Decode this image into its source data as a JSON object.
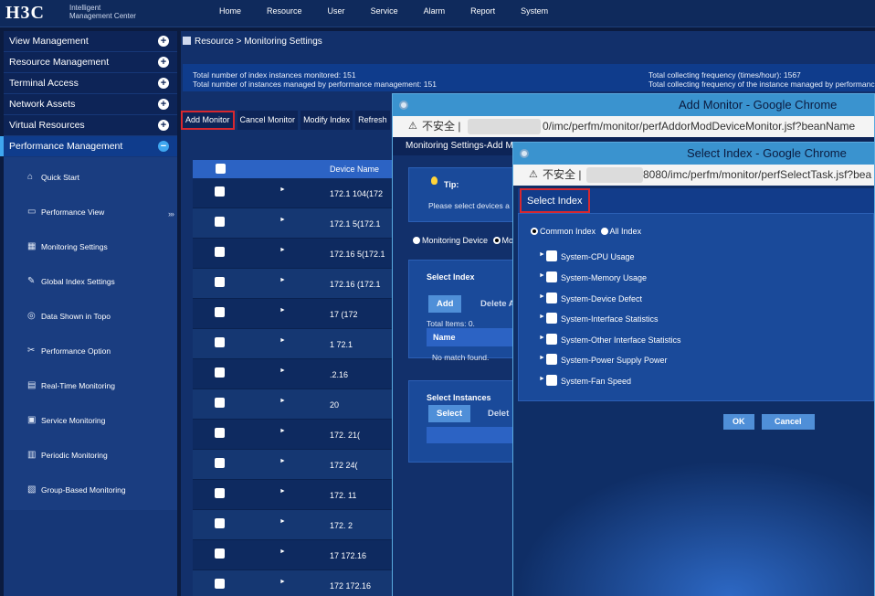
{
  "app": {
    "logo": "H3C",
    "logo_sub_1": "Intelligent",
    "logo_sub_2": "Management Center"
  },
  "topnav": [
    "Home",
    "Resource",
    "User",
    "Service",
    "Alarm",
    "Report",
    "System"
  ],
  "sidebar": {
    "menus": [
      {
        "label": "View Management",
        "icon": "plus-icon"
      },
      {
        "label": "Resource Management",
        "icon": "plus-icon"
      },
      {
        "label": "Terminal Access",
        "icon": "plus-icon"
      },
      {
        "label": "Network Assets",
        "icon": "plus-icon"
      },
      {
        "label": "Virtual Resources",
        "icon": "plus-icon"
      },
      {
        "label": "Performance Management",
        "icon": "minus-icon"
      }
    ],
    "sub_items": [
      {
        "label": "Quick Start",
        "icon": "home-icon"
      },
      {
        "label": "Performance View",
        "icon": "monitor-icon"
      },
      {
        "label": "Monitoring Settings",
        "icon": "settings-icon"
      },
      {
        "label": "Global Index Settings",
        "icon": "edit-icon"
      },
      {
        "label": "Data Shown in Topo",
        "icon": "topo-icon"
      },
      {
        "label": "Performance Option",
        "icon": "wrench-icon"
      },
      {
        "label": "Real-Time Monitoring",
        "icon": "realtime-icon"
      },
      {
        "label": "Service Monitoring",
        "icon": "service-icon"
      },
      {
        "label": "Periodic Monitoring",
        "icon": "periodic-icon"
      },
      {
        "label": "Group-Based Monitoring",
        "icon": "group-icon"
      }
    ],
    "expand_glyph": "›››"
  },
  "breadcrumb": "Resource > Monitoring Settings",
  "stats": {
    "line1": "Total number of index instances monitored: 151",
    "line2": "Total number of instances managed by performance management: 151",
    "line3": "Total collecting frequency (times/hour): 1567",
    "line4": "Total collecting frequency of the instance managed by performance"
  },
  "toolbar": {
    "add": "Add Monitor",
    "cancel": "Cancel Monitor",
    "modify": "Modify Index",
    "refresh": "Refresh"
  },
  "table": {
    "header": "Device Name",
    "rows": [
      "172.1     104(172",
      "172.1     5(172.1",
      "172.16    5(172.1",
      "172.16    (172.1",
      "17         (172",
      "1          72.1",
      "           .2.16",
      "            20",
      "172.       21(",
      "172        24(",
      "172.        11",
      "172.        2",
      "17         172.16",
      "172         172.16"
    ]
  },
  "dialog_add": {
    "title": "Add Monitor - Google Chrome",
    "secure_label": "不安全 |",
    "url": "0/imc/perfm/monitor/perfAddorModDeviceMonitor.jsf?beanName",
    "header": "Monitoring Settings-Add M",
    "tip_title": "Tip:",
    "tip_text": "Please select devices a",
    "radio_device": "Monitoring Device",
    "radio_other": "Mo",
    "select_index": "Select Index",
    "add_btn": "Add",
    "delete_btn": "Delete A",
    "total_items": "Total Items: 0.",
    "name_col": "Name",
    "no_match": "No match found.",
    "select_instances": "Select Instances",
    "select_btn": "Select",
    "delete_btn2": "Delet"
  },
  "dialog_select": {
    "title": "Select Index - Google Chrome",
    "secure_label": "不安全 |",
    "url": "8080/imc/perfm/monitor/perfSelectTask.jsf?bea",
    "header": "Select Index",
    "radio_common": "Common Index",
    "radio_all": "All Index",
    "indexes": [
      "System-CPU Usage",
      "System-Memory Usage",
      "System-Device Defect",
      "System-Interface Statistics",
      "System-Other Interface Statistics",
      "System-Power Supply Power",
      "System-Fan Speed"
    ],
    "ok": "OK",
    "cancel": "Cancel"
  }
}
